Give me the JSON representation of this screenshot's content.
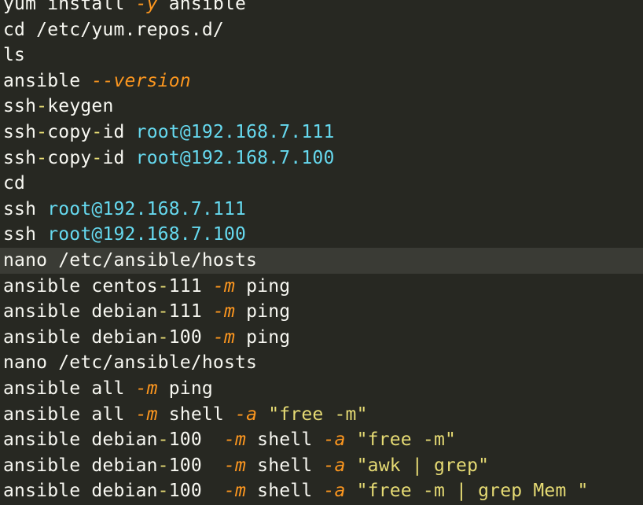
{
  "colors": {
    "background": "#272822",
    "current_line": "#3a3b35",
    "text": "#f8f8f2",
    "flag": "#fd971f",
    "address": "#66d9ef",
    "string": "#e6db74",
    "operator": "#e6db74"
  },
  "lines": [
    {
      "current": false,
      "tokens": [
        {
          "t": "cmd",
          "v": "yum install "
        },
        {
          "t": "flag",
          "v": "-y"
        },
        {
          "t": "cmd",
          "v": " ansible"
        }
      ]
    },
    {
      "current": false,
      "tokens": [
        {
          "t": "cmd",
          "v": "cd /etc/yum.repos.d/"
        }
      ]
    },
    {
      "current": false,
      "tokens": [
        {
          "t": "cmd",
          "v": "ls"
        }
      ]
    },
    {
      "current": false,
      "tokens": [
        {
          "t": "cmd",
          "v": "ansible "
        },
        {
          "t": "flag",
          "v": "--version"
        }
      ]
    },
    {
      "current": false,
      "tokens": [
        {
          "t": "cmd",
          "v": "ssh"
        },
        {
          "t": "op",
          "v": "-"
        },
        {
          "t": "cmd",
          "v": "keygen"
        }
      ]
    },
    {
      "current": false,
      "tokens": [
        {
          "t": "cmd",
          "v": "ssh"
        },
        {
          "t": "op",
          "v": "-"
        },
        {
          "t": "cmd",
          "v": "copy"
        },
        {
          "t": "op",
          "v": "-"
        },
        {
          "t": "cmd",
          "v": "id "
        },
        {
          "t": "addr",
          "v": "root@192.168.7.111"
        }
      ]
    },
    {
      "current": false,
      "tokens": [
        {
          "t": "cmd",
          "v": "ssh"
        },
        {
          "t": "op",
          "v": "-"
        },
        {
          "t": "cmd",
          "v": "copy"
        },
        {
          "t": "op",
          "v": "-"
        },
        {
          "t": "cmd",
          "v": "id "
        },
        {
          "t": "addr",
          "v": "root@192.168.7.100"
        }
      ]
    },
    {
      "current": false,
      "tokens": [
        {
          "t": "cmd",
          "v": "cd"
        }
      ]
    },
    {
      "current": false,
      "tokens": [
        {
          "t": "cmd",
          "v": "ssh "
        },
        {
          "t": "addr",
          "v": "root@192.168.7.111"
        }
      ]
    },
    {
      "current": false,
      "tokens": [
        {
          "t": "cmd",
          "v": "ssh "
        },
        {
          "t": "addr",
          "v": "root@192.168.7.100"
        }
      ]
    },
    {
      "current": true,
      "tokens": [
        {
          "t": "cmd",
          "v": "nano /etc/ansible/hosts"
        }
      ]
    },
    {
      "current": false,
      "tokens": [
        {
          "t": "cmd",
          "v": "ansible centos"
        },
        {
          "t": "op",
          "v": "-"
        },
        {
          "t": "cmd",
          "v": "111 "
        },
        {
          "t": "flag",
          "v": "-m"
        },
        {
          "t": "cmd",
          "v": " ping"
        }
      ]
    },
    {
      "current": false,
      "tokens": [
        {
          "t": "cmd",
          "v": "ansible debian"
        },
        {
          "t": "op",
          "v": "-"
        },
        {
          "t": "cmd",
          "v": "111 "
        },
        {
          "t": "flag",
          "v": "-m"
        },
        {
          "t": "cmd",
          "v": " ping"
        }
      ]
    },
    {
      "current": false,
      "tokens": [
        {
          "t": "cmd",
          "v": "ansible debian"
        },
        {
          "t": "op",
          "v": "-"
        },
        {
          "t": "cmd",
          "v": "100 "
        },
        {
          "t": "flag",
          "v": "-m"
        },
        {
          "t": "cmd",
          "v": " ping"
        }
      ]
    },
    {
      "current": false,
      "tokens": [
        {
          "t": "cmd",
          "v": "nano /etc/ansible/hosts"
        }
      ]
    },
    {
      "current": false,
      "tokens": [
        {
          "t": "cmd",
          "v": "ansible all "
        },
        {
          "t": "flag",
          "v": "-m"
        },
        {
          "t": "cmd",
          "v": " ping"
        }
      ]
    },
    {
      "current": false,
      "tokens": [
        {
          "t": "cmd",
          "v": "ansible all "
        },
        {
          "t": "flag",
          "v": "-m"
        },
        {
          "t": "cmd",
          "v": " shell "
        },
        {
          "t": "flag",
          "v": "-a"
        },
        {
          "t": "cmd",
          "v": " "
        },
        {
          "t": "str",
          "v": "\"free -m\""
        }
      ]
    },
    {
      "current": false,
      "tokens": [
        {
          "t": "cmd",
          "v": "ansible debian"
        },
        {
          "t": "op",
          "v": "-"
        },
        {
          "t": "cmd",
          "v": "100  "
        },
        {
          "t": "flag",
          "v": "-m"
        },
        {
          "t": "cmd",
          "v": " shell "
        },
        {
          "t": "flag",
          "v": "-a"
        },
        {
          "t": "cmd",
          "v": " "
        },
        {
          "t": "str",
          "v": "\"free -m\""
        }
      ]
    },
    {
      "current": false,
      "tokens": [
        {
          "t": "cmd",
          "v": "ansible debian"
        },
        {
          "t": "op",
          "v": "-"
        },
        {
          "t": "cmd",
          "v": "100  "
        },
        {
          "t": "flag",
          "v": "-m"
        },
        {
          "t": "cmd",
          "v": " shell "
        },
        {
          "t": "flag",
          "v": "-a"
        },
        {
          "t": "cmd",
          "v": " "
        },
        {
          "t": "str",
          "v": "\"awk | grep\""
        }
      ]
    },
    {
      "current": false,
      "tokens": [
        {
          "t": "cmd",
          "v": "ansible debian"
        },
        {
          "t": "op",
          "v": "-"
        },
        {
          "t": "cmd",
          "v": "100  "
        },
        {
          "t": "flag",
          "v": "-m"
        },
        {
          "t": "cmd",
          "v": " shell "
        },
        {
          "t": "flag",
          "v": "-a"
        },
        {
          "t": "cmd",
          "v": " "
        },
        {
          "t": "str",
          "v": "\"free -m | grep Mem \""
        }
      ]
    }
  ]
}
